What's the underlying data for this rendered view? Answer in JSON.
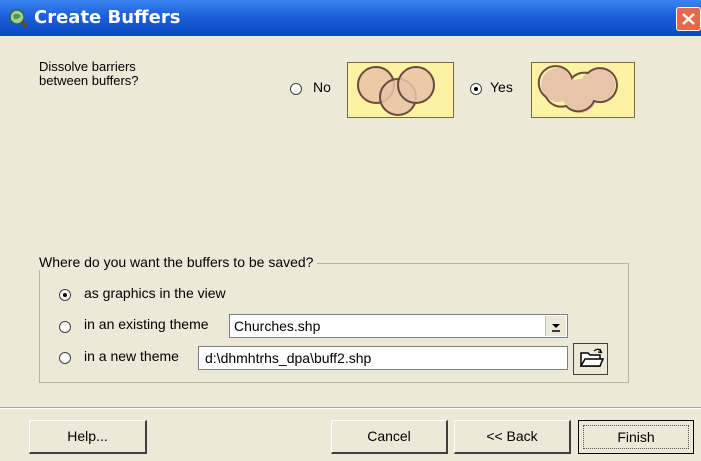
{
  "window": {
    "title": "Create Buffers"
  },
  "dissolve": {
    "question_line1": "Dissolve barriers",
    "question_line2": "between buffers?",
    "option_no": "No",
    "option_yes": "Yes",
    "selected": "Yes"
  },
  "save": {
    "legend": "Where do you want the buffers to be saved?",
    "option_graphics": "as graphics in the view",
    "option_existing": "in an existing theme",
    "option_new": "in a new theme",
    "selected": "as graphics in the view",
    "existing_theme_value": "Churches.shp",
    "new_theme_path": "d:\\dhmhtrhs_dpa\\buff2.shp"
  },
  "buttons": {
    "help": "Help...",
    "cancel": "Cancel",
    "back": "<< Back",
    "finish": "Finish"
  },
  "colors": {
    "titlebar": "#1d5fd8",
    "dialog_bg": "#ece9d8",
    "preview_bg": "#fdf1a4",
    "buffer_fill": "#e8c4a8",
    "close_button": "#e56a4a"
  },
  "icons": {
    "app": "globe-magnifier-icon",
    "close": "close-icon",
    "browse": "open-folder-icon",
    "dropdown": "chevron-down-icon"
  }
}
